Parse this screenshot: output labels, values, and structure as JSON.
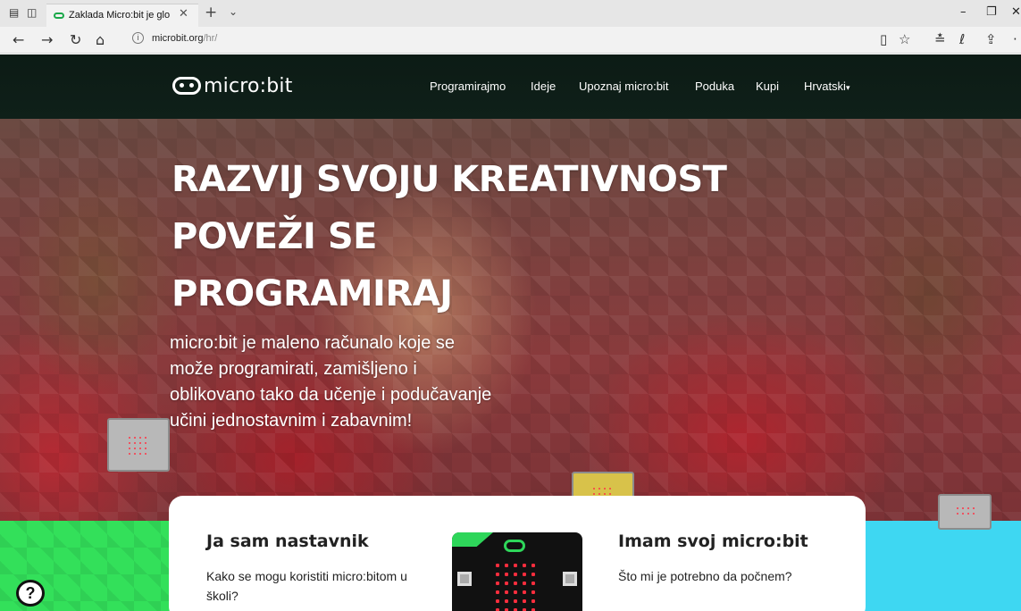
{
  "browser": {
    "tab_title": "Zaklada Micro:bit je glo",
    "url_host": "microbit.org",
    "url_path": "/hr/"
  },
  "site": {
    "logo_text": "micro:bit",
    "nav": [
      {
        "label": "Programirajmo"
      },
      {
        "label": "Ideje"
      },
      {
        "label": "Upoznaj micro:bit"
      },
      {
        "label": "Poduka"
      },
      {
        "label": "Kupi"
      },
      {
        "label": "Hrvatski"
      }
    ]
  },
  "hero": {
    "headline_1": "RAZVIJ SVOJU KREATIVNOST",
    "headline_2": "POVEŽI SE",
    "headline_3": "PROGRAMIRAJ",
    "description": "micro:bit je maleno računalo koje se može programirati, zamišljeno i oblikovano tako da učenje i podučavanje učini jednostavnim i zabavnim!"
  },
  "cards": {
    "teacher_title": "Ja sam nastavnik",
    "teacher_text": "Kako se mogu koristiti micro:bitom u školi?",
    "owner_title": "Imam svoj micro:bit",
    "owner_text": "Što mi je potrebno da počnem?"
  },
  "colors": {
    "nav_bg": "#0c1b15",
    "green_band": "#33e05a",
    "cyan_band": "#3ed7f2"
  }
}
